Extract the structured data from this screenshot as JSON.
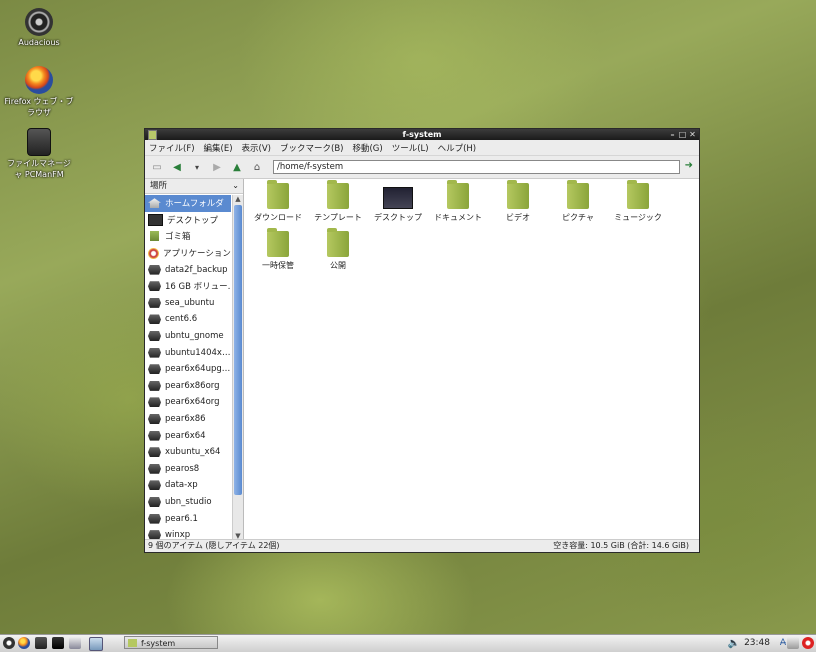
{
  "desktop": {
    "icons": [
      {
        "label": "Audacious"
      },
      {
        "label": "Firefox ウェブ・ブラウザ"
      },
      {
        "label": "ファイルマネージャ PCManFM"
      }
    ]
  },
  "window": {
    "title": "f-system",
    "menu": [
      "ファイル(F)",
      "編集(E)",
      "表示(V)",
      "ブックマーク(B)",
      "移動(G)",
      "ツール(L)",
      "ヘルプ(H)"
    ],
    "address": "/home/f-system",
    "sidebar_header": "場所",
    "places": [
      "ホームフォルダ",
      "デスクトップ",
      "ゴミ箱",
      "アプリケーション",
      "data2f_backup",
      "16 GB ボリュー…",
      "sea_ubuntu",
      "cent6.6",
      "ubntu_gnome",
      "ubuntu1404x…",
      "pear6x64upg…",
      "pear6x86org",
      "pear6x64org",
      "pear6x86",
      "pear6x64",
      "xubuntu_x64",
      "pearos8",
      "data-xp",
      "ubn_studio",
      "pear6.1",
      "winxp"
    ],
    "files": [
      {
        "label": "ダウンロード",
        "type": "folder"
      },
      {
        "label": "テンプレート",
        "type": "folder"
      },
      {
        "label": "デスクトップ",
        "type": "desktop"
      },
      {
        "label": "ドキュメント",
        "type": "folder"
      },
      {
        "label": "ビデオ",
        "type": "folder"
      },
      {
        "label": "ピクチャ",
        "type": "folder"
      },
      {
        "label": "ミュージック",
        "type": "folder"
      },
      {
        "label": "一時保管",
        "type": "folder"
      },
      {
        "label": "公開",
        "type": "folder"
      }
    ],
    "status_left": "9 個のアイテム (隠しアイテム 22個)",
    "status_right": "空き容量: 10.5 GiB (合計: 14.6 GiB)"
  },
  "taskbar": {
    "task_label": "f-system",
    "clock": "23:48",
    "ime": "A̶"
  }
}
